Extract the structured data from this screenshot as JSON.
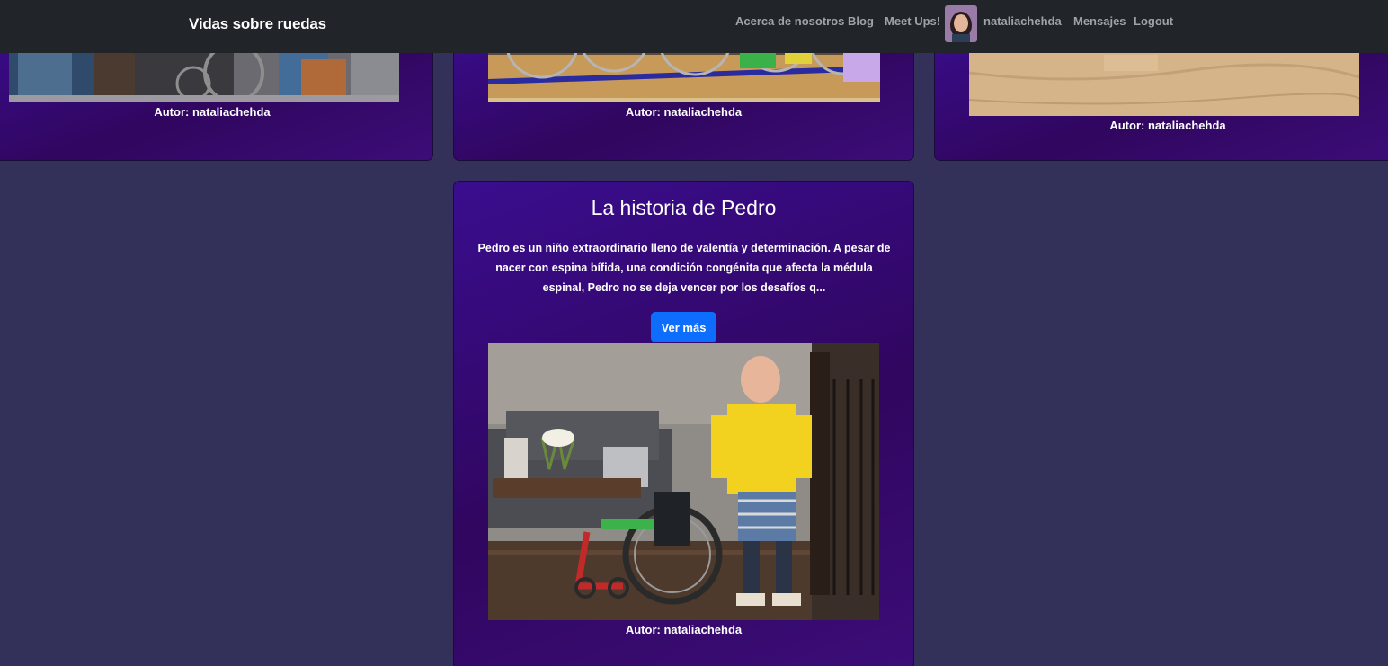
{
  "navbar": {
    "brand": "Vidas sobre ruedas",
    "links": [
      "Acerca de nosotros",
      "Blog",
      "Meet Ups!"
    ],
    "username": "nataliachehda",
    "messages": "Mensajes",
    "logout": "Logout"
  },
  "cards": [
    {
      "author": "Autor: nataliachehda"
    },
    {
      "author": "Autor: nataliachehda"
    },
    {
      "author": "Autor: nataliachehda"
    },
    {
      "title": "La historia de Pedro",
      "excerpt": "Pedro es un niño extraordinario lleno de valentía y determinación. A pesar de nacer con espina bífida, una condición congénita que afecta la médula espinal, Pedro no se deja vencer por los desafíos q...",
      "button": "Ver más",
      "author": "Autor: nataliachehda"
    }
  ],
  "colors": {
    "background": "#33305a",
    "navbar": "#212529",
    "card": "#30065f",
    "button": "#0d6efd"
  }
}
